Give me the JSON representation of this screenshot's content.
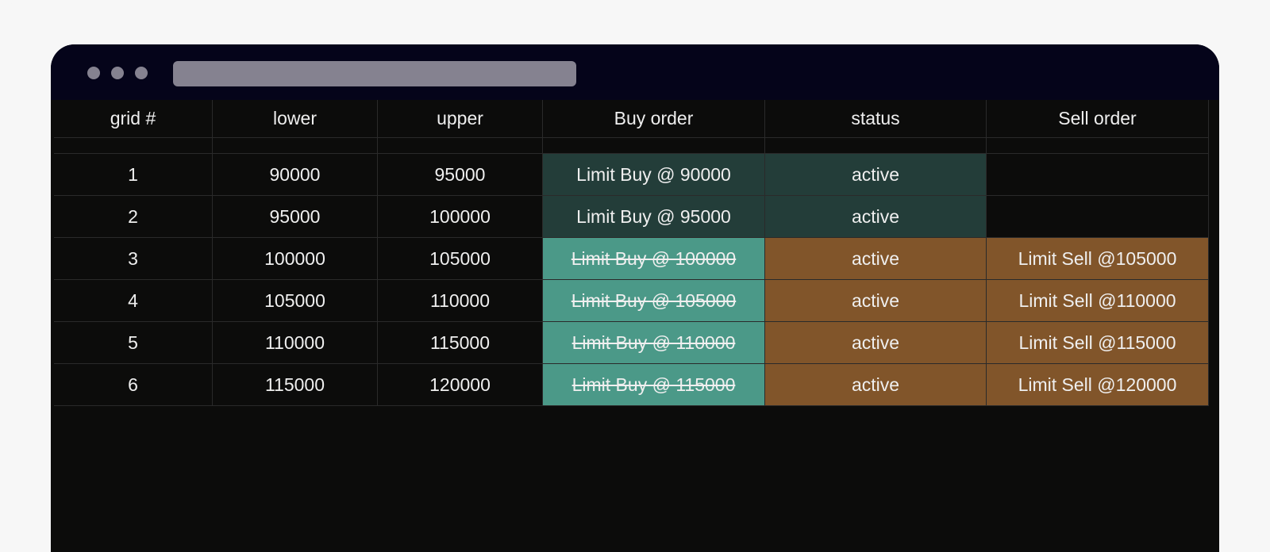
{
  "table": {
    "headers": [
      "grid #",
      "lower",
      "upper",
      "Buy order",
      "status",
      "Sell order"
    ],
    "rows": [
      {
        "grid": "1",
        "lower": "90000",
        "upper": "95000",
        "buy": "Limit Buy @ 90000",
        "buy_filled": false,
        "status": "active",
        "sell": ""
      },
      {
        "grid": "2",
        "lower": "95000",
        "upper": "100000",
        "buy": "Limit Buy @ 95000",
        "buy_filled": false,
        "status": "active",
        "sell": ""
      },
      {
        "grid": "3",
        "lower": "100000",
        "upper": "105000",
        "buy": "Limit Buy @ 100000",
        "buy_filled": true,
        "status": "active",
        "sell": "Limit Sell @105000"
      },
      {
        "grid": "4",
        "lower": "105000",
        "upper": "110000",
        "buy": "Limit Buy @ 105000",
        "buy_filled": true,
        "status": "active",
        "sell": "Limit Sell @110000"
      },
      {
        "grid": "5",
        "lower": "110000",
        "upper": "115000",
        "buy": "Limit Buy @ 110000",
        "buy_filled": true,
        "status": "active",
        "sell": "Limit Sell @115000"
      },
      {
        "grid": "6",
        "lower": "115000",
        "upper": "120000",
        "buy": "Limit Buy @ 115000",
        "buy_filled": true,
        "status": "active",
        "sell": "Limit Sell @120000"
      }
    ]
  },
  "colors": {
    "background": "#0c0c0b",
    "titlebar": "#05041a",
    "pending_buy": "#233d39",
    "filled_buy": "#4b9988",
    "sell_active": "#81552a",
    "text": "#efefef"
  }
}
